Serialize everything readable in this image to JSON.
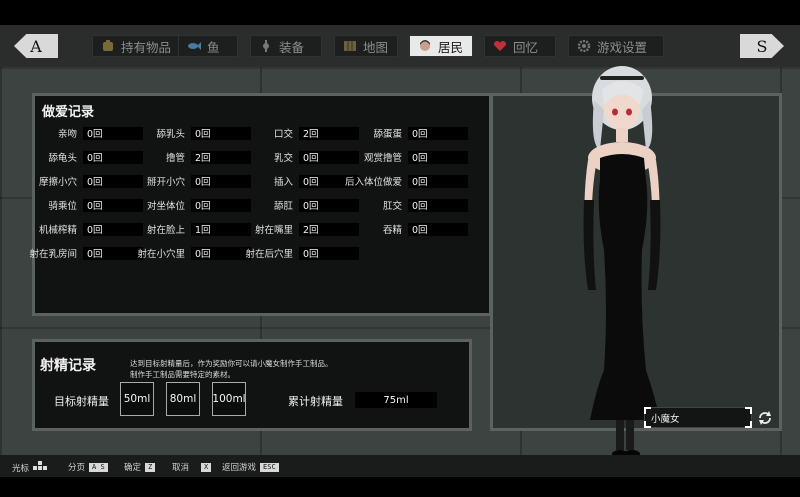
{
  "nav": {
    "prev": "A",
    "next": "S"
  },
  "tabs": [
    {
      "label": "持有物品",
      "icon": "backpack-icon",
      "active": false
    },
    {
      "label": "鱼",
      "icon": "fish-icon",
      "active": false
    },
    {
      "label": "装备",
      "icon": "equipment-icon",
      "active": false
    },
    {
      "label": "地图",
      "icon": "map-icon",
      "active": false
    },
    {
      "label": "居民",
      "icon": "resident-icon",
      "active": true
    },
    {
      "label": "回忆",
      "icon": "heart-icon",
      "active": false
    },
    {
      "label": "游戏设置",
      "icon": "gear-icon",
      "active": false
    }
  ],
  "records": {
    "title": "做爱记录",
    "stats": [
      {
        "label": "亲吻",
        "value": "0回"
      },
      {
        "label": "舔乳头",
        "value": "0回"
      },
      {
        "label": "口交",
        "value": "2回"
      },
      {
        "label": "舔蛋蛋",
        "value": "0回"
      },
      {
        "label": "舔龟头",
        "value": "0回"
      },
      {
        "label": "撸管",
        "value": "2回"
      },
      {
        "label": "乳交",
        "value": "0回"
      },
      {
        "label": "观赏撸管",
        "value": "0回"
      },
      {
        "label": "摩擦小穴",
        "value": "0回"
      },
      {
        "label": "掰开小穴",
        "value": "0回"
      },
      {
        "label": "插入",
        "value": "0回"
      },
      {
        "label": "后入体位做爱",
        "value": "0回"
      },
      {
        "label": "骑乘位",
        "value": "0回"
      },
      {
        "label": "对坐体位",
        "value": "0回"
      },
      {
        "label": "舔肛",
        "value": "0回"
      },
      {
        "label": "肛交",
        "value": "0回"
      },
      {
        "label": "机械榨精",
        "value": "0回"
      },
      {
        "label": "射在脸上",
        "value": "1回"
      },
      {
        "label": "射在嘴里",
        "value": "2回"
      },
      {
        "label": "吞精",
        "value": "0回"
      },
      {
        "label": "射在乳房间",
        "value": "0回"
      },
      {
        "label": "射在小穴里",
        "value": "0回"
      },
      {
        "label": "射在后穴里",
        "value": "0回"
      }
    ]
  },
  "ejaculation": {
    "title": "射精记录",
    "desc1": "达到目标射精量后，作为奖励你可以请小魔女制作手工制品。",
    "desc2": "制作手工制品需要特定的素材。",
    "goal_label": "目标射精量",
    "goals": [
      "50ml",
      "80ml",
      "100ml"
    ],
    "accum_label": "累计射精量",
    "accum_value": "75ml"
  },
  "character": {
    "name": "小魔女"
  },
  "hints": [
    {
      "label": "光标",
      "key": ""
    },
    {
      "label": "分页",
      "key": "A S"
    },
    {
      "label": "确定",
      "key": "Z"
    },
    {
      "label": "取消",
      "key": "X"
    },
    {
      "label": "返回游戏",
      "key": "ESC"
    }
  ],
  "colors": {
    "panel_bg": "#101312",
    "wall": "#3d4340",
    "accent": "#e9e9e9"
  }
}
